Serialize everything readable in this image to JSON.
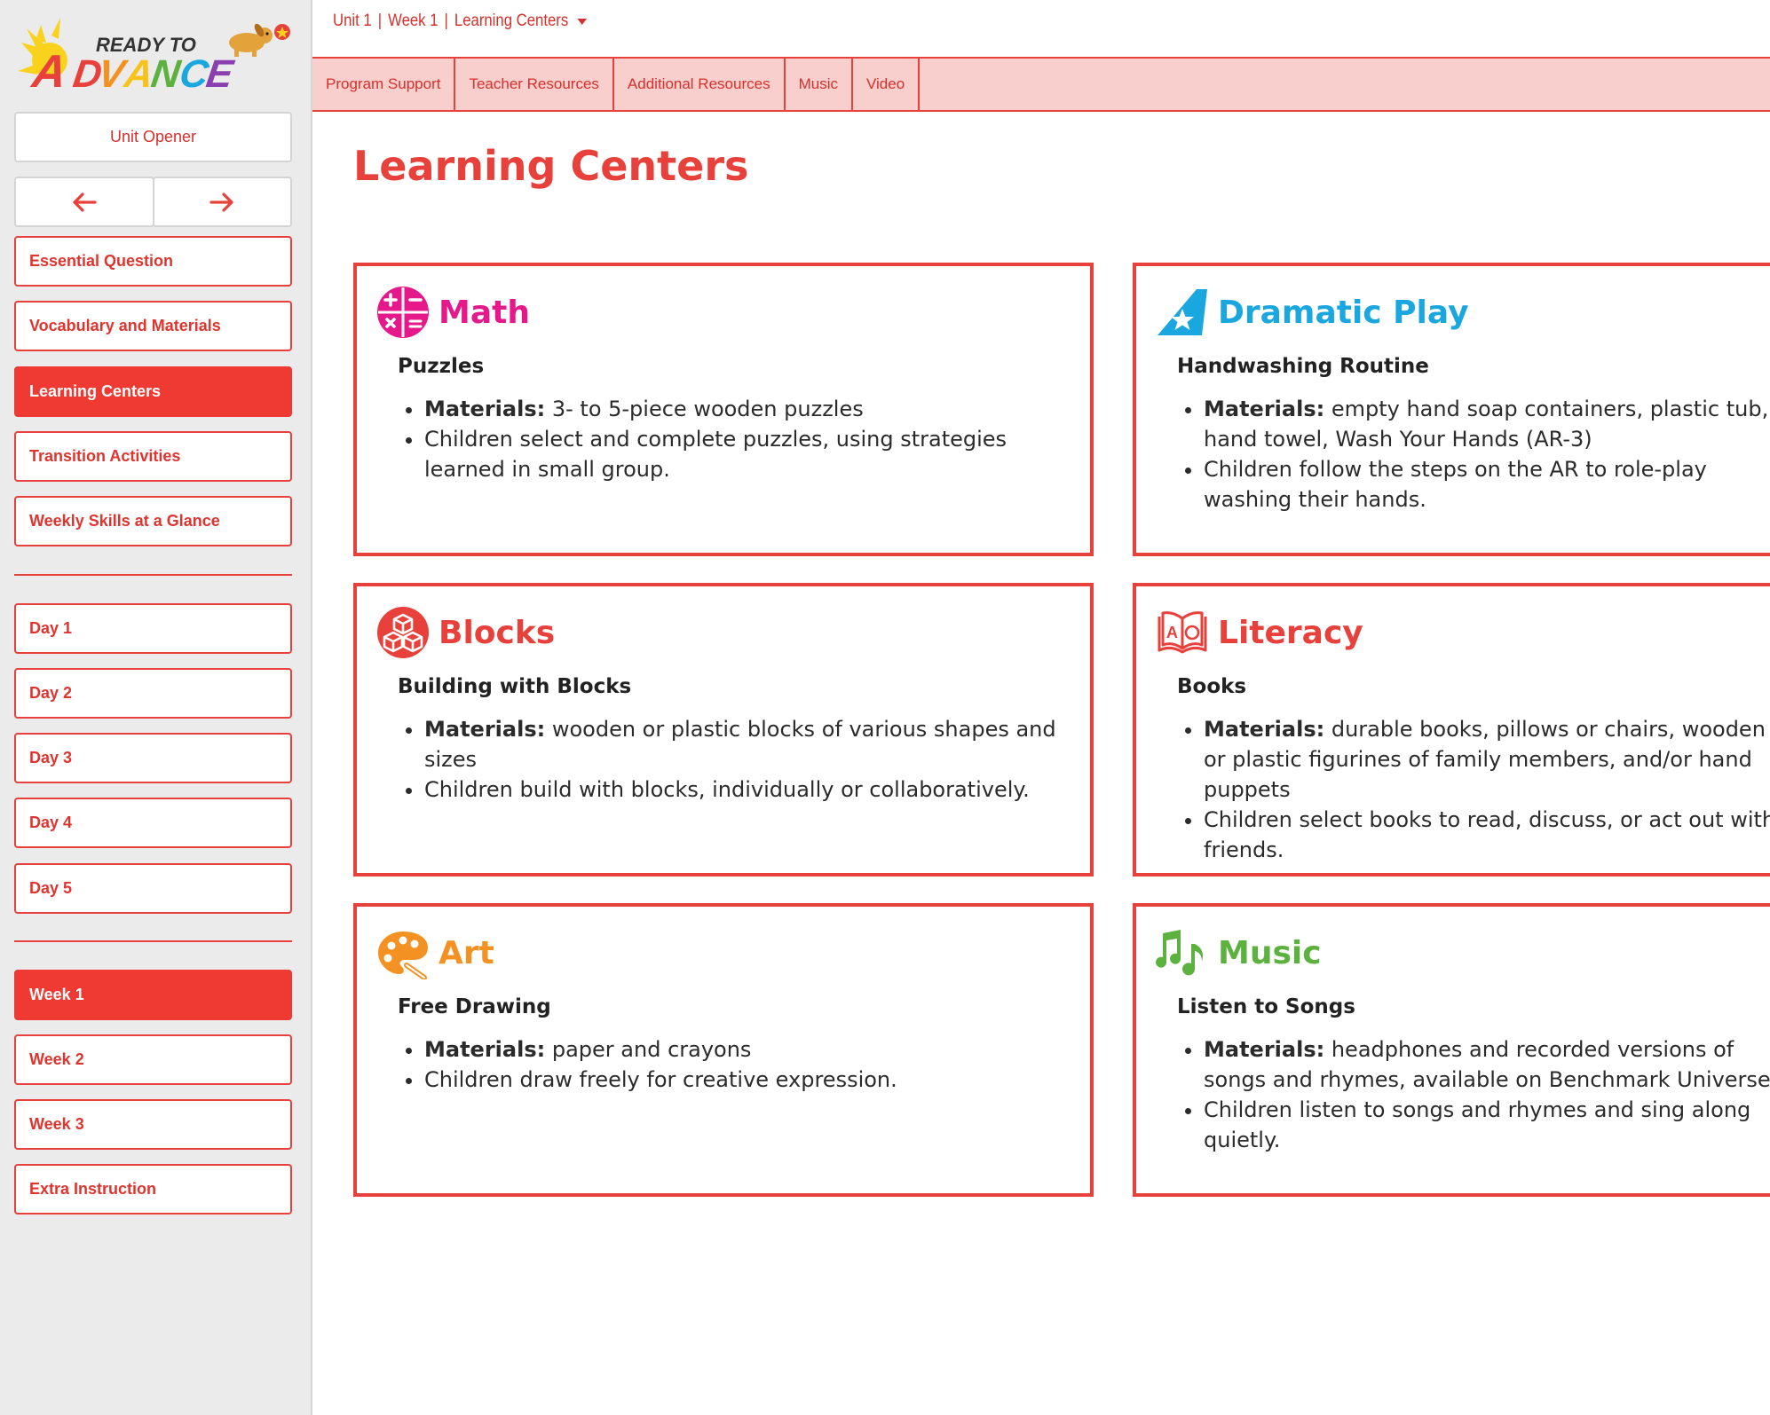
{
  "app": {
    "logo": {
      "line1": "READY TO",
      "line2": "ADVANCE"
    }
  },
  "breadcrumb": {
    "unit": "Unit 1",
    "week": "Week 1",
    "page": "Learning Centers",
    "separator": "|"
  },
  "tabs": [
    "Program Support",
    "Teacher Resources",
    "Additional Resources",
    "Music",
    "Video"
  ],
  "sidebar": {
    "unit_opener": "Unit Opener",
    "sections": [
      "Essential Question",
      "Vocabulary and Materials",
      "Learning Centers",
      "Transition Activities",
      "Weekly Skills at a Glance"
    ],
    "active_section": "Learning Centers",
    "days": [
      "Day 1",
      "Day 2",
      "Day 3",
      "Day 4",
      "Day 5"
    ],
    "weeks": [
      "Week 1",
      "Week 2",
      "Week 3",
      "Extra Instruction"
    ],
    "active_week": "Week 1"
  },
  "page": {
    "title": "Learning Centers"
  },
  "centers": [
    {
      "title": "Math",
      "color": "#e5198a",
      "icon": "math-icon",
      "activity": "Puzzles",
      "materials_label": "Materials:",
      "materials": "3- to 5-piece wooden puzzles",
      "description": "Children select and complete puzzles, using strategies learned in small group."
    },
    {
      "title": "Dramatic Play",
      "color": "#1aa6df",
      "icon": "star-icon",
      "activity": "Handwashing Routine",
      "materials_label": "Materials:",
      "materials": "empty hand soap containers, plastic tub, hand towel, Wash Your Hands (AR-3)",
      "description": "Children follow the steps on the AR to role-play washing their hands."
    },
    {
      "title": "Blocks",
      "color": "#e8403a",
      "icon": "blocks-icon",
      "activity": "Building with Blocks",
      "materials_label": "Materials:",
      "materials": "wooden or plastic blocks of various shapes and sizes",
      "description": "Children build with blocks, individually or collaboratively."
    },
    {
      "title": "Literacy",
      "color": "#e8403a",
      "icon": "book-icon",
      "activity": "Books",
      "materials_label": "Materials:",
      "materials": "durable books, pillows or chairs, wooden or plastic figurines of family members, and/or hand puppets",
      "description": "Children select books to read, discuss, or act out with friends."
    },
    {
      "title": "Art",
      "color": "#f39223",
      "icon": "palette-icon",
      "activity": "Free Drawing",
      "materials_label": "Materials:",
      "materials": "paper and crayons",
      "description": "Children draw freely for creative expression."
    },
    {
      "title": "Music",
      "color": "#5db13f",
      "icon": "music-note-icon",
      "activity": "Listen to Songs",
      "materials_label": "Materials:",
      "materials": "headphones and recorded versions of songs and rhymes, available on Benchmark Universe",
      "description": "Children listen to songs and rhymes and sing along quietly."
    }
  ]
}
